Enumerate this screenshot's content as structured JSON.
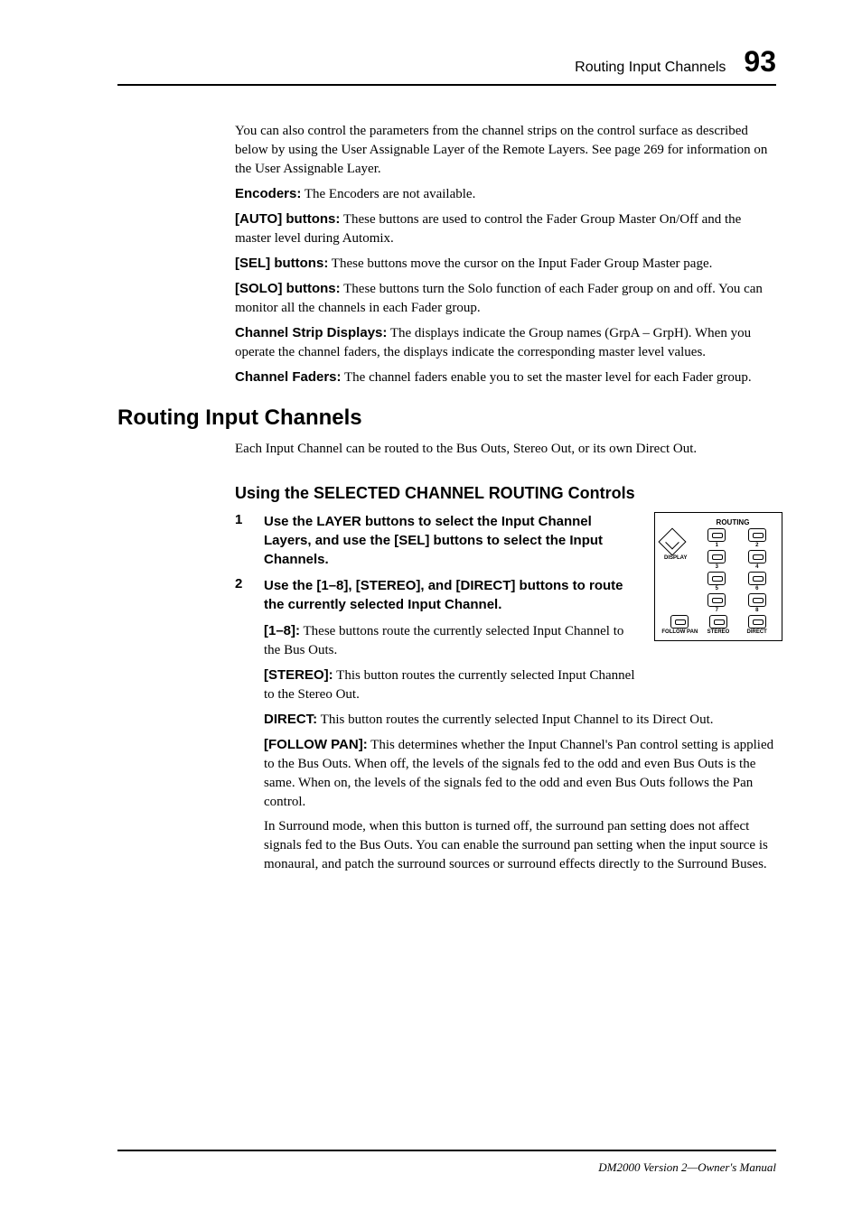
{
  "header": {
    "title": "Routing Input Channels",
    "page_number": "93"
  },
  "intro_paras": [
    "You can also control the parameters from the channel strips on the control surface as described below by using the User Assignable Layer of the Remote Layers. See page 269 for information on the User Assignable Layer."
  ],
  "terms_top": [
    {
      "term": "Encoders:",
      "desc": " The Encoders are not available."
    },
    {
      "term": "[AUTO] buttons:",
      "desc": " These buttons are used to control the Fader Group Master On/Off and the master level during Automix."
    },
    {
      "term": "[SEL] buttons:",
      "desc": " These buttons move the cursor on the Input Fader Group Master page."
    },
    {
      "term": "[SOLO] buttons:",
      "desc": " These buttons turn the Solo function of each Fader group on and off. You can monitor all the channels in each Fader group."
    },
    {
      "term": "Channel Strip Displays:",
      "desc": " The displays indicate the Group names (GrpA – GrpH). When you operate the channel faders, the displays indicate the corresponding master level values."
    },
    {
      "term": "Channel Faders:",
      "desc": " The channel faders enable you to set the master level for each Fader group."
    }
  ],
  "h1": "Routing Input Channels",
  "h1_desc": "Each Input Channel can be routed to the Bus Outs, Stereo Out, or its own Direct Out.",
  "h2": "Using the SELECTED CHANNEL ROUTING Controls",
  "steps": [
    {
      "num": "1",
      "text": "Use the LAYER buttons to select the Input Channel Layers, and use the [SEL] buttons to select the Input Channels."
    },
    {
      "num": "2",
      "text": "Use the [1–8], [STEREO], and [DIRECT] buttons to route the currently selected Input Channel."
    }
  ],
  "terms_routing": [
    {
      "term": "[1–8]:",
      "desc": " These buttons route the currently selected Input Channel to the Bus Outs."
    },
    {
      "term": "[STEREO]:",
      "desc": " This button routes the currently selected Input Channel to the Stereo Out."
    },
    {
      "term": "DIRECT:",
      "desc": " This button routes the currently selected Input Channel to its Direct Out."
    },
    {
      "term": "[FOLLOW PAN]:",
      "desc": " This determines whether the Input Channel's Pan control setting is applied to the Bus Outs. When off, the levels of the signals fed to the odd and even Bus Outs is the same. When on, the levels of the signals fed to the odd and even Bus Outs follows the Pan control."
    }
  ],
  "surround_para": "In Surround mode, when this button is turned off, the surround pan setting does not affect signals fed to the Bus Outs. You can enable the surround pan setting when the input source is monaural, and patch the surround sources or surround effects directly to the Surround Buses.",
  "diagram": {
    "title": "ROUTING",
    "display_label": "DISPLAY",
    "buttons": [
      "1",
      "2",
      "3",
      "4",
      "5",
      "6",
      "7",
      "8"
    ],
    "bottom": [
      "FOLLOW PAN",
      "STEREO",
      "DIRECT"
    ]
  },
  "footer": "DM2000 Version 2—Owner's Manual"
}
